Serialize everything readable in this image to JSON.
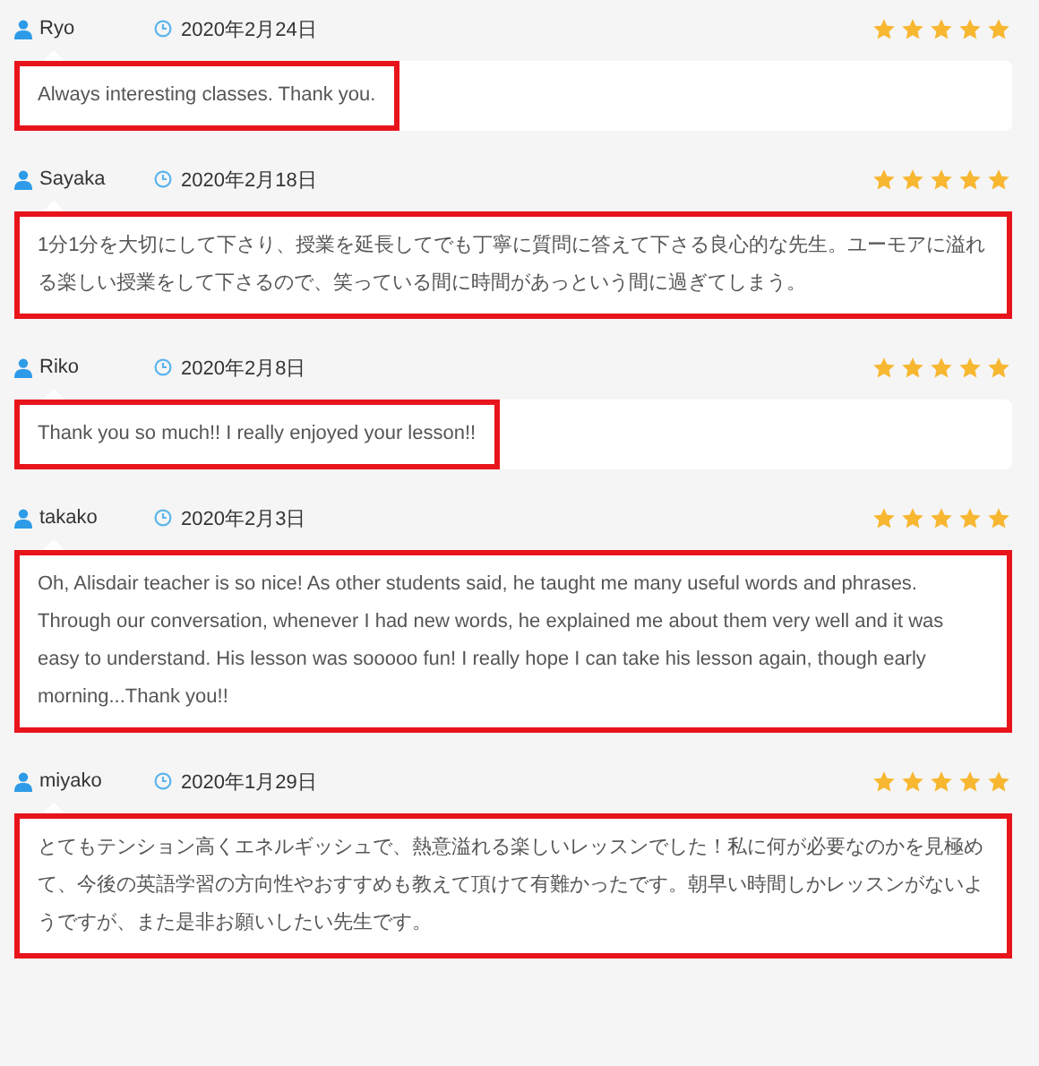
{
  "reviews": [
    {
      "name": "Ryo",
      "date": "2020年2月24日",
      "stars": 5,
      "highlighted": true,
      "comment": "Always interesting classes. Thank you."
    },
    {
      "name": "Sayaka",
      "date": "2020年2月18日",
      "stars": 5,
      "highlighted": true,
      "comment": "1分1分を大切にして下さり、授業を延長してでも丁寧に質問に答えて下さる良心的な先生。ユーモアに溢れる楽しい授業をして下さるので、笑っている間に時間があっという間に過ぎてしまう。"
    },
    {
      "name": "Riko",
      "date": "2020年2月8日",
      "stars": 5,
      "highlighted": true,
      "comment": "Thank you so much!! I really enjoyed your lesson!!"
    },
    {
      "name": "takako",
      "date": "2020年2月3日",
      "stars": 5,
      "highlighted": true,
      "comment": "Oh, Alisdair teacher is so nice! As other students said, he taught me many useful words and phrases. Through our conversation, whenever I had new words, he explained me about them very well and it was easy to understand. His lesson was sooooo fun! I really hope I can take his lesson again, though early morning...Thank you!!"
    },
    {
      "name": "miyako",
      "date": "2020年1月29日",
      "stars": 5,
      "highlighted": true,
      "comment": "とてもテンション高くエネルギッシュで、熱意溢れる楽しいレッスンでした！私に何が必要なのかを見極めて、今後の英語学習の方向性やおすすめも教えて頂けて有難かったです。朝早い時間しかレッスンがないようですが、また是非お願いしたい先生です。"
    }
  ]
}
